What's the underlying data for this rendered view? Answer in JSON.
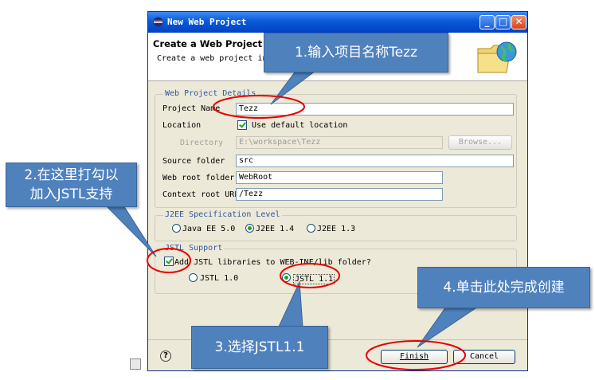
{
  "window": {
    "title": "New Web Project",
    "header_title": "Create a Web Project",
    "header_desc": "Create a web project in",
    "controls": [
      "_",
      "□",
      "✕"
    ]
  },
  "details": {
    "legend": "Web Project Details",
    "project_name_label": "Project Name",
    "project_name_value": "Tezz",
    "location_label": "Location",
    "use_default_label": "Use default location",
    "directory_label": "Directory",
    "directory_value": "E:\\workspace\\Tezz",
    "browse_label": "Browse...",
    "source_folder_label": "Source folder",
    "source_folder_value": "src",
    "web_root_label": "Web root folder",
    "web_root_value": "WebRoot",
    "context_root_label": "Context root URL",
    "context_root_value": "/Tezz"
  },
  "j2ee": {
    "legend": "J2EE Specification Level",
    "options": [
      "Java EE 5.0",
      "J2EE 1.4",
      "J2EE 1.3"
    ],
    "selected": "J2EE 1.4"
  },
  "jstl": {
    "legend": "JSTL Support",
    "checkbox_label": "Add JSTL libraries to WEB-INF/lib folder?",
    "checked": true,
    "options": [
      "JSTL 1.0",
      "JSTL 1.1"
    ],
    "selected": "JSTL 1.1"
  },
  "footer": {
    "help": "?",
    "finish_label": "Finish",
    "cancel_label": "Cancel"
  },
  "callouts": {
    "c1": "1.输入项目名称Tezz",
    "c2_line1": "2.在这里打勾以",
    "c2_line2": "加入JSTL支持",
    "c3": "3.选择JSTL1.1",
    "c4": "4.单击此处完成创建"
  },
  "colors": {
    "callout": "#4f81bd",
    "highlight": "#e60000",
    "title_bar": "#0a5ad8"
  }
}
